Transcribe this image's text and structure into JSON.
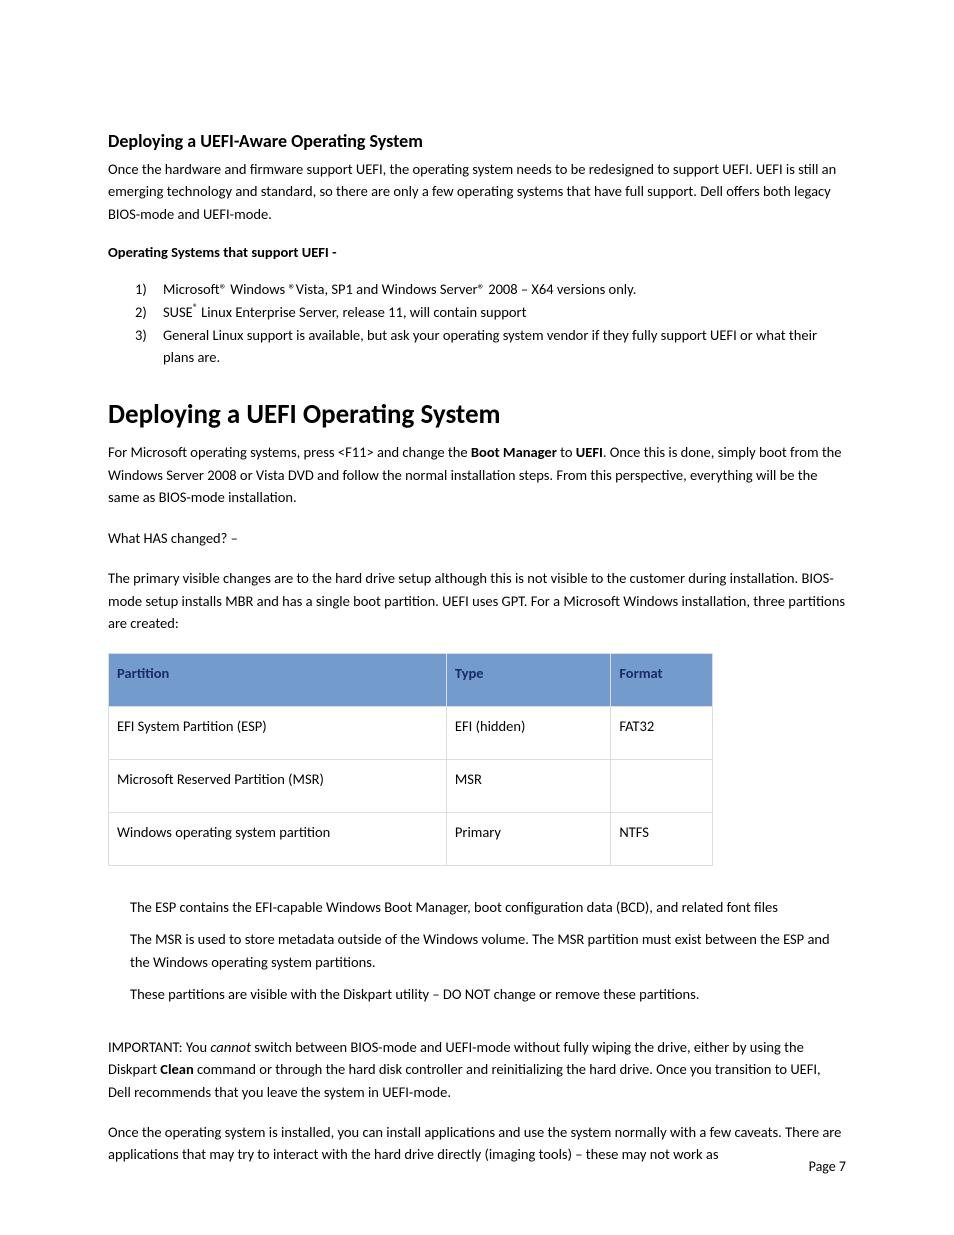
{
  "section1": {
    "heading": "Deploying a UEFI-Aware Operating System",
    "intro": "Once the hardware and firmware support UEFI, the operating system needs to be redesigned to support UEFI. UEFI is still an emerging technology and standard, so there are only a few operating systems that have full support. Dell offers both legacy BIOS-mode and UEFI-mode.",
    "support_heading": "Operating Systems that support UEFI -",
    "list": [
      {
        "marker": "1)",
        "text": "Microsoft® Windows ®Vista, SP1 and Windows Server® 2008 – X64 versions only."
      },
      {
        "marker": "2)",
        "text_pre": "SUSE",
        "sup": "®",
        "text_post": " Linux Enterprise Server, release 11, will contain support"
      },
      {
        "marker": "3)",
        "text": "General Linux support is available, but ask your operating system vendor if they fully support UEFI or what their plans are."
      }
    ]
  },
  "section2": {
    "heading": "Deploying a UEFI Operating System",
    "p1_a": "For Microsoft operating systems, press <F11> and change the ",
    "p1_b1": "Boot Manager",
    "p1_c": " to ",
    "p1_b2": "UEFI",
    "p1_d": ". Once this is done, simply boot from the Windows Server 2008 or Vista DVD and follow the normal installation steps.  From this perspective, everything will be the same as BIOS-mode installation.",
    "p2": "What HAS changed? –",
    "p3": "The primary visible changes are to the hard drive setup although this is not visible to the customer during installation.  BIOS-mode setup installs MBR and has a single boot partition.  UEFI uses GPT.  For a Microsoft Windows installation, three partitions are created:"
  },
  "table": {
    "headers": {
      "partition": "Partition",
      "type": "Type",
      "format": "Format"
    },
    "rows": [
      {
        "partition": "EFI System Partition (ESP)",
        "type": "EFI (hidden)",
        "format": "FAT32"
      },
      {
        "partition": "Microsoft Reserved Partition (MSR)",
        "type": "MSR",
        "format": ""
      },
      {
        "partition": "Windows operating system partition",
        "type": "Primary",
        "format": "NTFS"
      }
    ]
  },
  "notes": {
    "n1": "The ESP contains the EFI-capable Windows Boot Manager, boot configuration data (BCD), and related font files",
    "n2": "The MSR is used to store metadata outside of the Windows volume. The MSR partition must exist between the ESP and the Windows operating system partitions.",
    "n3": "These partitions are visible with the Diskpart utility – DO NOT change or remove these partitions."
  },
  "important": {
    "a": "IMPORTANT:  You ",
    "b_i": "cannot",
    "c": " switch between BIOS-mode and UEFI-mode without fully wiping the drive, either by using the Diskpart ",
    "d_b": "Clean",
    "e": " command or through the hard disk controller and reinitializing the hard drive.  Once you transition to UEFI, Dell recommends that you leave the system in UEFI-mode."
  },
  "closing": "Once the operating system is installed, you can install applications and use the system normally with a few caveats.  There are applications that may try to interact with the hard drive directly (imaging tools) – these may not work as",
  "page_number": "Page 7"
}
